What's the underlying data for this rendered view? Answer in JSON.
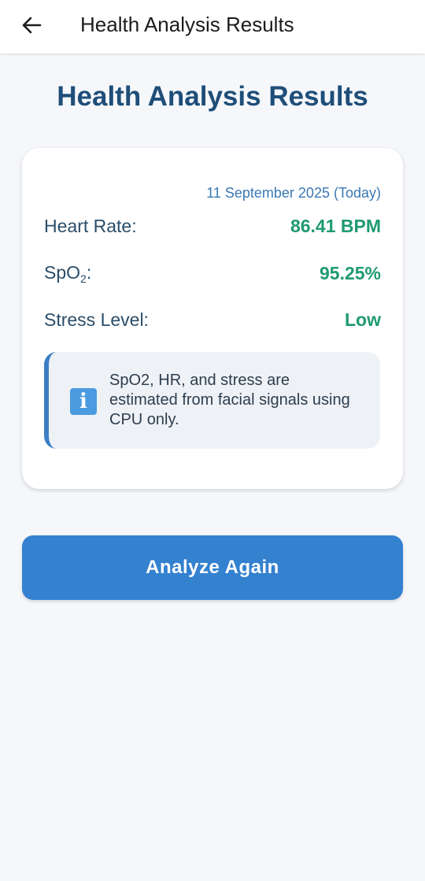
{
  "app_bar": {
    "title": "Health Analysis Results",
    "back_icon": "arrow-left-icon"
  },
  "heading": "Health Analysis Results",
  "results": {
    "date": "11 September 2025 (Today)",
    "heart_rate": {
      "label": "Heart Rate:",
      "value": "86.41 BPM"
    },
    "spo2": {
      "label_main": "SpO",
      "label_sub": "2",
      "label_suffix": ":",
      "value": "95.25%"
    },
    "stress": {
      "label": "Stress Level:",
      "value": "Low"
    },
    "value_color": "#1f9a6f"
  },
  "info": {
    "icon": "info-icon",
    "icon_glyph": "i",
    "text": "SpO2, HR, and stress are estimated from facial signals using CPU only."
  },
  "actions": {
    "analyze_again_label": "Analyze Again",
    "button_color": "#3481d0"
  }
}
